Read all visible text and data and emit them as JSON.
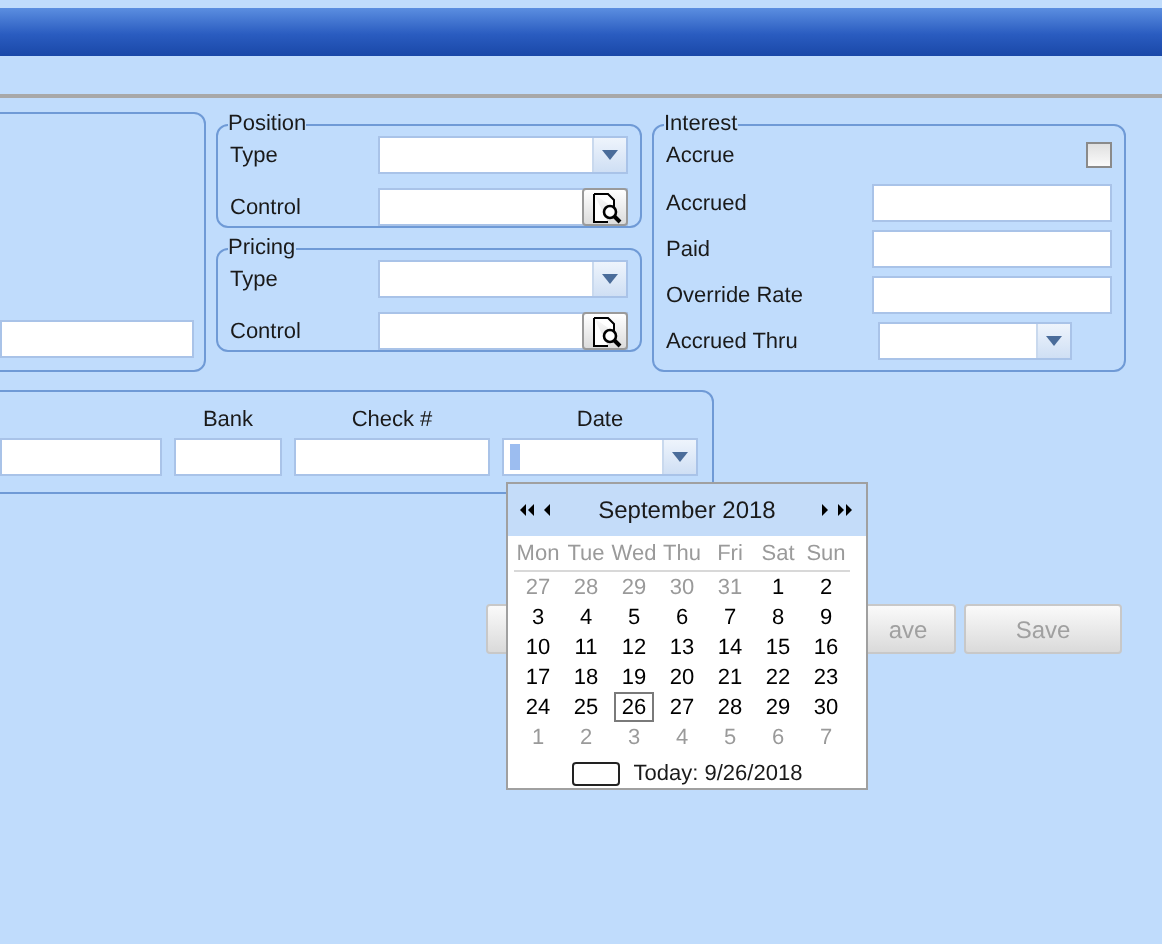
{
  "position": {
    "title": "Position",
    "rows": [
      {
        "label": "Type",
        "kind": "dropdown"
      },
      {
        "label": "Control",
        "kind": "lookup"
      }
    ]
  },
  "pricing": {
    "title": "Pricing",
    "rows": [
      {
        "label": "Type",
        "kind": "dropdown"
      },
      {
        "label": "Control",
        "kind": "lookup"
      }
    ]
  },
  "interest": {
    "title": "Interest",
    "accrue": {
      "label": "Accrue",
      "checked": false
    },
    "fields": [
      {
        "label": "Accrued",
        "kind": "text"
      },
      {
        "label": "Paid",
        "kind": "text"
      },
      {
        "label": "Override Rate",
        "kind": "text"
      },
      {
        "label": "Accrued Thru",
        "kind": "dropdown"
      }
    ]
  },
  "payment": {
    "columns": [
      {
        "label": "Bank"
      },
      {
        "label": "Check #"
      },
      {
        "label": "Date"
      }
    ]
  },
  "calendar": {
    "month": "September 2018",
    "weekdays": [
      "Mon",
      "Tue",
      "Wed",
      "Thu",
      "Fri",
      "Sat",
      "Sun"
    ],
    "weeks": [
      [
        {
          "day": "27",
          "muted": true,
          "selected": false
        },
        {
          "day": "28",
          "muted": true,
          "selected": false
        },
        {
          "day": "29",
          "muted": true,
          "selected": false
        },
        {
          "day": "30",
          "muted": true,
          "selected": false
        },
        {
          "day": "31",
          "muted": true,
          "selected": false
        },
        {
          "day": "1",
          "muted": false,
          "selected": false
        },
        {
          "day": "2",
          "muted": false,
          "selected": false
        }
      ],
      [
        {
          "day": "3",
          "muted": false,
          "selected": false
        },
        {
          "day": "4",
          "muted": false,
          "selected": false
        },
        {
          "day": "5",
          "muted": false,
          "selected": false
        },
        {
          "day": "6",
          "muted": false,
          "selected": false
        },
        {
          "day": "7",
          "muted": false,
          "selected": false
        },
        {
          "day": "8",
          "muted": false,
          "selected": false
        },
        {
          "day": "9",
          "muted": false,
          "selected": false
        }
      ],
      [
        {
          "day": "10",
          "muted": false,
          "selected": false
        },
        {
          "day": "11",
          "muted": false,
          "selected": false
        },
        {
          "day": "12",
          "muted": false,
          "selected": false
        },
        {
          "day": "13",
          "muted": false,
          "selected": false
        },
        {
          "day": "14",
          "muted": false,
          "selected": false
        },
        {
          "day": "15",
          "muted": false,
          "selected": false
        },
        {
          "day": "16",
          "muted": false,
          "selected": false
        }
      ],
      [
        {
          "day": "17",
          "muted": false,
          "selected": false
        },
        {
          "day": "18",
          "muted": false,
          "selected": false
        },
        {
          "day": "19",
          "muted": false,
          "selected": false
        },
        {
          "day": "20",
          "muted": false,
          "selected": false
        },
        {
          "day": "21",
          "muted": false,
          "selected": false
        },
        {
          "day": "22",
          "muted": false,
          "selected": false
        },
        {
          "day": "23",
          "muted": false,
          "selected": false
        }
      ],
      [
        {
          "day": "24",
          "muted": false,
          "selected": false
        },
        {
          "day": "25",
          "muted": false,
          "selected": false
        },
        {
          "day": "26",
          "muted": false,
          "selected": true
        },
        {
          "day": "27",
          "muted": false,
          "selected": false
        },
        {
          "day": "28",
          "muted": false,
          "selected": false
        },
        {
          "day": "29",
          "muted": false,
          "selected": false
        },
        {
          "day": "30",
          "muted": false,
          "selected": false
        }
      ],
      [
        {
          "day": "1",
          "muted": true,
          "selected": false
        },
        {
          "day": "2",
          "muted": true,
          "selected": false
        },
        {
          "day": "3",
          "muted": true,
          "selected": false
        },
        {
          "day": "4",
          "muted": true,
          "selected": false
        },
        {
          "day": "5",
          "muted": true,
          "selected": false
        },
        {
          "day": "6",
          "muted": true,
          "selected": false
        },
        {
          "day": "7",
          "muted": true,
          "selected": false
        }
      ]
    ],
    "today": "Today: 9/26/2018"
  },
  "buttons": [
    {
      "label": "ave",
      "disabled": true
    },
    {
      "label": "Save",
      "disabled": true
    }
  ]
}
